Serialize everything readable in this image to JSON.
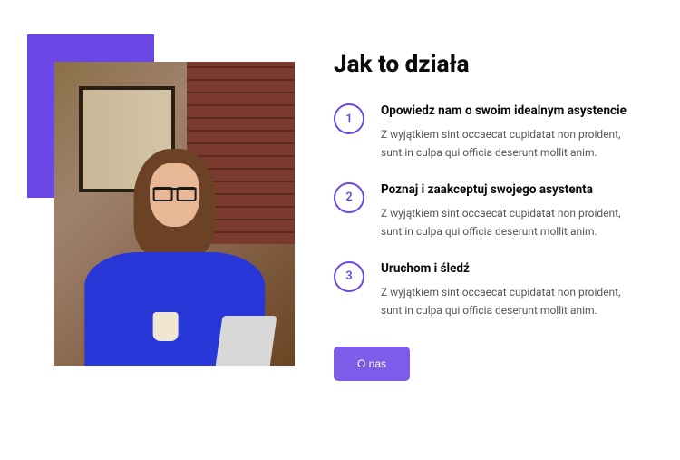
{
  "title": "Jak to działa",
  "steps": [
    {
      "num": "1",
      "title": "Opowiedz nam o swoim idealnym asystencie",
      "desc": "Z wyjątkiem sint occaecat cupidatat non proident, sunt in culpa qui officia deserunt mollit anim."
    },
    {
      "num": "2",
      "title": "Poznaj i zaakceptuj swojego asystenta",
      "desc": "Z wyjątkiem sint occaecat cupidatat non proident, sunt in culpa qui officia deserunt mollit anim."
    },
    {
      "num": "3",
      "title": "Uruchom i śledź",
      "desc": "Z wyjątkiem sint occaecat cupidatat non proident, sunt in culpa qui officia deserunt mollit anim."
    }
  ],
  "cta_label": "O nas",
  "colors": {
    "accent": "#6c47e5"
  }
}
